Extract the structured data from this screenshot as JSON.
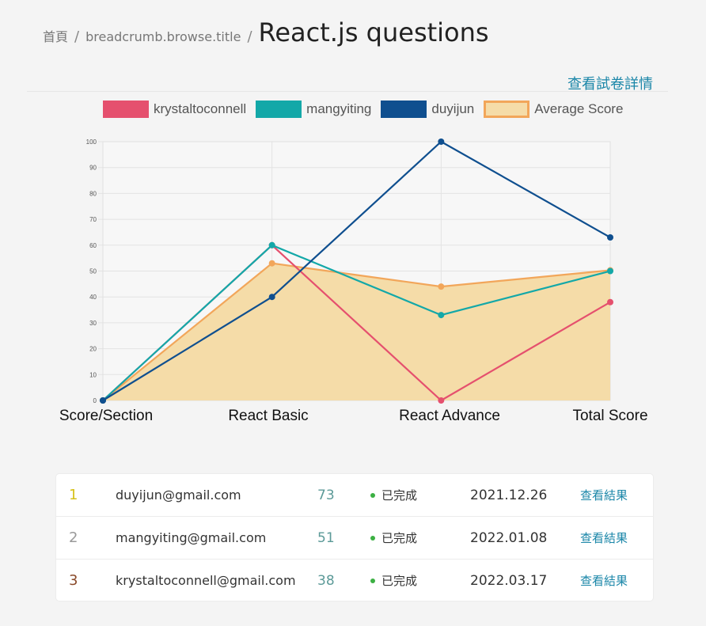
{
  "breadcrumb": {
    "home": "首頁",
    "middle": "breadcrumb.browse.title",
    "separator": "/",
    "title": "React.js questions"
  },
  "detail_link": "查看試卷詳情",
  "chart_data": {
    "type": "line",
    "categories": [
      "Score/Section",
      "React Basic",
      "React Advance",
      "Total Score"
    ],
    "ylim": [
      0,
      100
    ],
    "yticks": [
      0,
      10,
      20,
      30,
      40,
      50,
      60,
      70,
      80,
      90,
      100
    ],
    "grid": true,
    "legend_position": "top",
    "series": [
      {
        "name": "krystaltoconnell",
        "values": [
          0,
          60,
          0,
          38
        ],
        "color": "#e5506e"
      },
      {
        "name": "mangyiting",
        "values": [
          0,
          60,
          33,
          50
        ],
        "color": "#13a8a8"
      },
      {
        "name": "duyijun",
        "values": [
          0,
          40,
          100,
          63
        ],
        "color": "#0f4f8f"
      },
      {
        "name": "Average Score",
        "values": [
          0,
          53,
          44,
          50.3
        ],
        "color": "#f2a65a",
        "fill": "#f5dca8",
        "area": true
      }
    ]
  },
  "results": [
    {
      "rank": "1",
      "rank_color": "#d6c11a",
      "email": "duyijun@gmail.com",
      "score": "73",
      "status": "已完成",
      "date": "2021.12.26",
      "action": "查看結果"
    },
    {
      "rank": "2",
      "rank_color": "#999999",
      "email": "mangyiting@gmail.com",
      "score": "51",
      "status": "已完成",
      "date": "2022.01.08",
      "action": "查看結果"
    },
    {
      "rank": "3",
      "rank_color": "#8a4a2a",
      "email": "krystaltoconnell@gmail.com",
      "score": "38",
      "status": "已完成",
      "date": "2022.03.17",
      "action": "查看結果"
    }
  ]
}
